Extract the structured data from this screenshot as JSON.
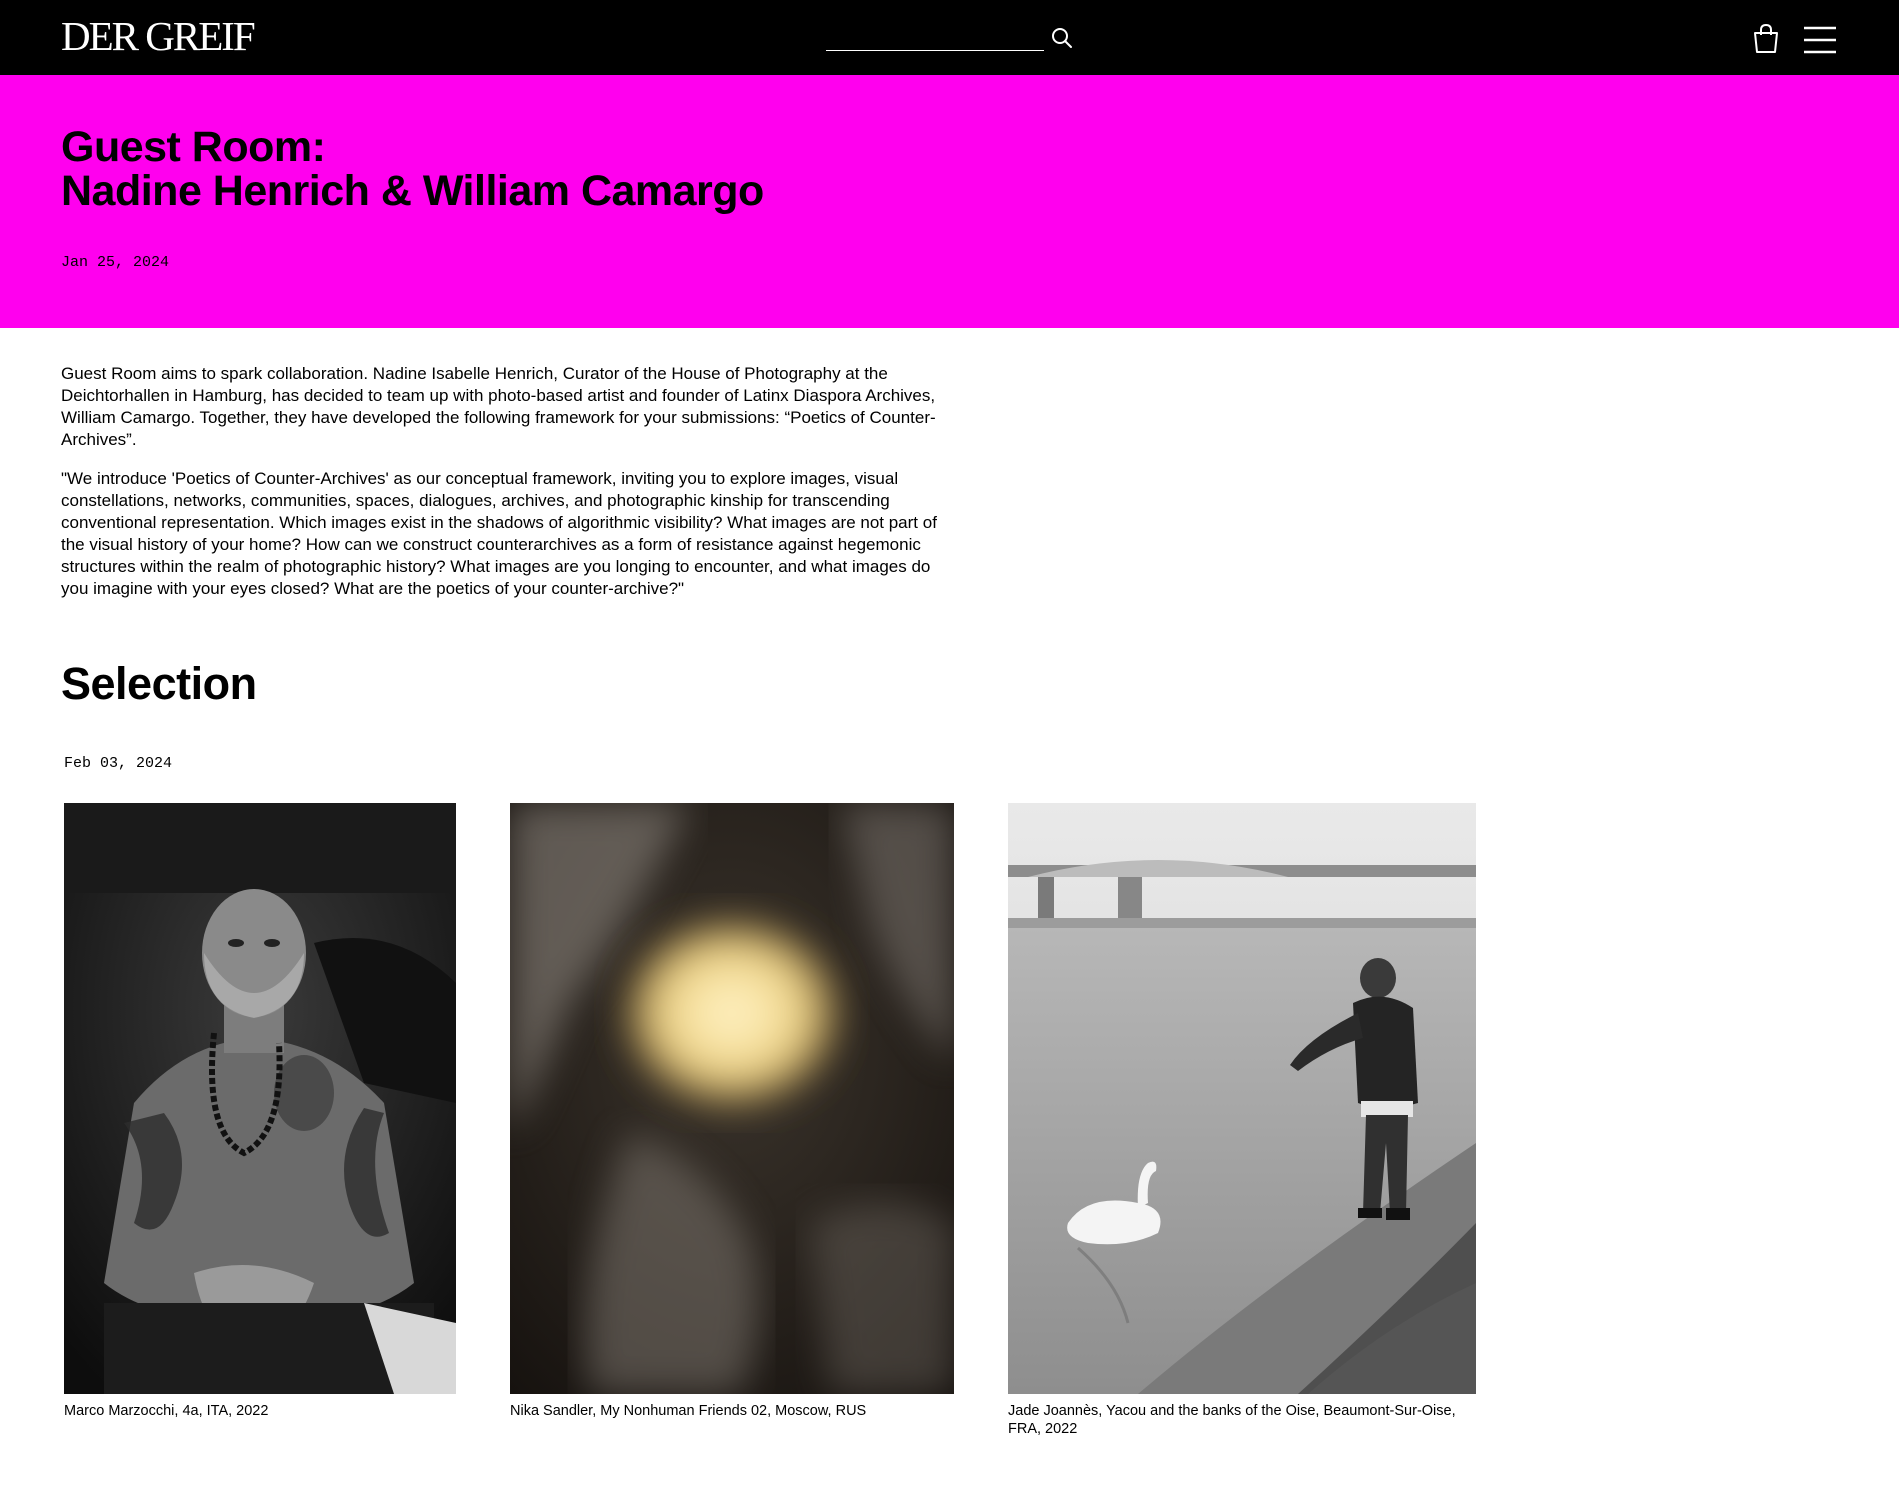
{
  "header": {
    "logo": "DER GREIF",
    "search": {
      "value": "",
      "placeholder": ""
    },
    "icons": [
      "search-icon",
      "shopping-bag-icon",
      "hamburger-menu-icon"
    ]
  },
  "hero": {
    "title_line1": "Guest Room:",
    "title_line2": "Nadine Henrich & William Camargo",
    "date": "Jan 25, 2024",
    "background": "#ff00ee"
  },
  "intro": {
    "paragraph1": "Guest Room aims to spark collaboration. Nadine Isabelle Henrich, Curator of the House of Photography at the Deichtorhallen in Hamburg, has decided to team up with photo-based artist and founder of Latinx Diaspora Archives, William Camargo. Together, they have developed the following framework for your submissions: “Poetics of Counter-Archives”.",
    "paragraph2": "\"We introduce 'Poetics of Counter-Archives' as our conceptual framework, inviting you to explore images, visual constellations, networks, communities, spaces, dialogues, archives, and photographic kinship for transcending conventional representation. Which images exist in the shadows of algorithmic visibility? What images are not part of the visual history of your home? How can we construct counterarchives as a form of resistance against hegemonic structures within the realm of photographic history? What images are you longing to encounter, and what images do you imagine with your eyes closed? What are the poetics of your counter-archive?\""
  },
  "selection": {
    "heading": "Selection",
    "date": "Feb 03, 2024",
    "photos": [
      {
        "caption": "Marco Marzocchi, 4a, ITA, 2022"
      },
      {
        "caption": "Nika Sandler, My Nonhuman Friends 02, Moscow, RUS"
      },
      {
        "caption": "Jade Joannès, Yacou and the banks of the Oise, Beaumont-Sur-Oise, FRA, 2022"
      }
    ]
  }
}
